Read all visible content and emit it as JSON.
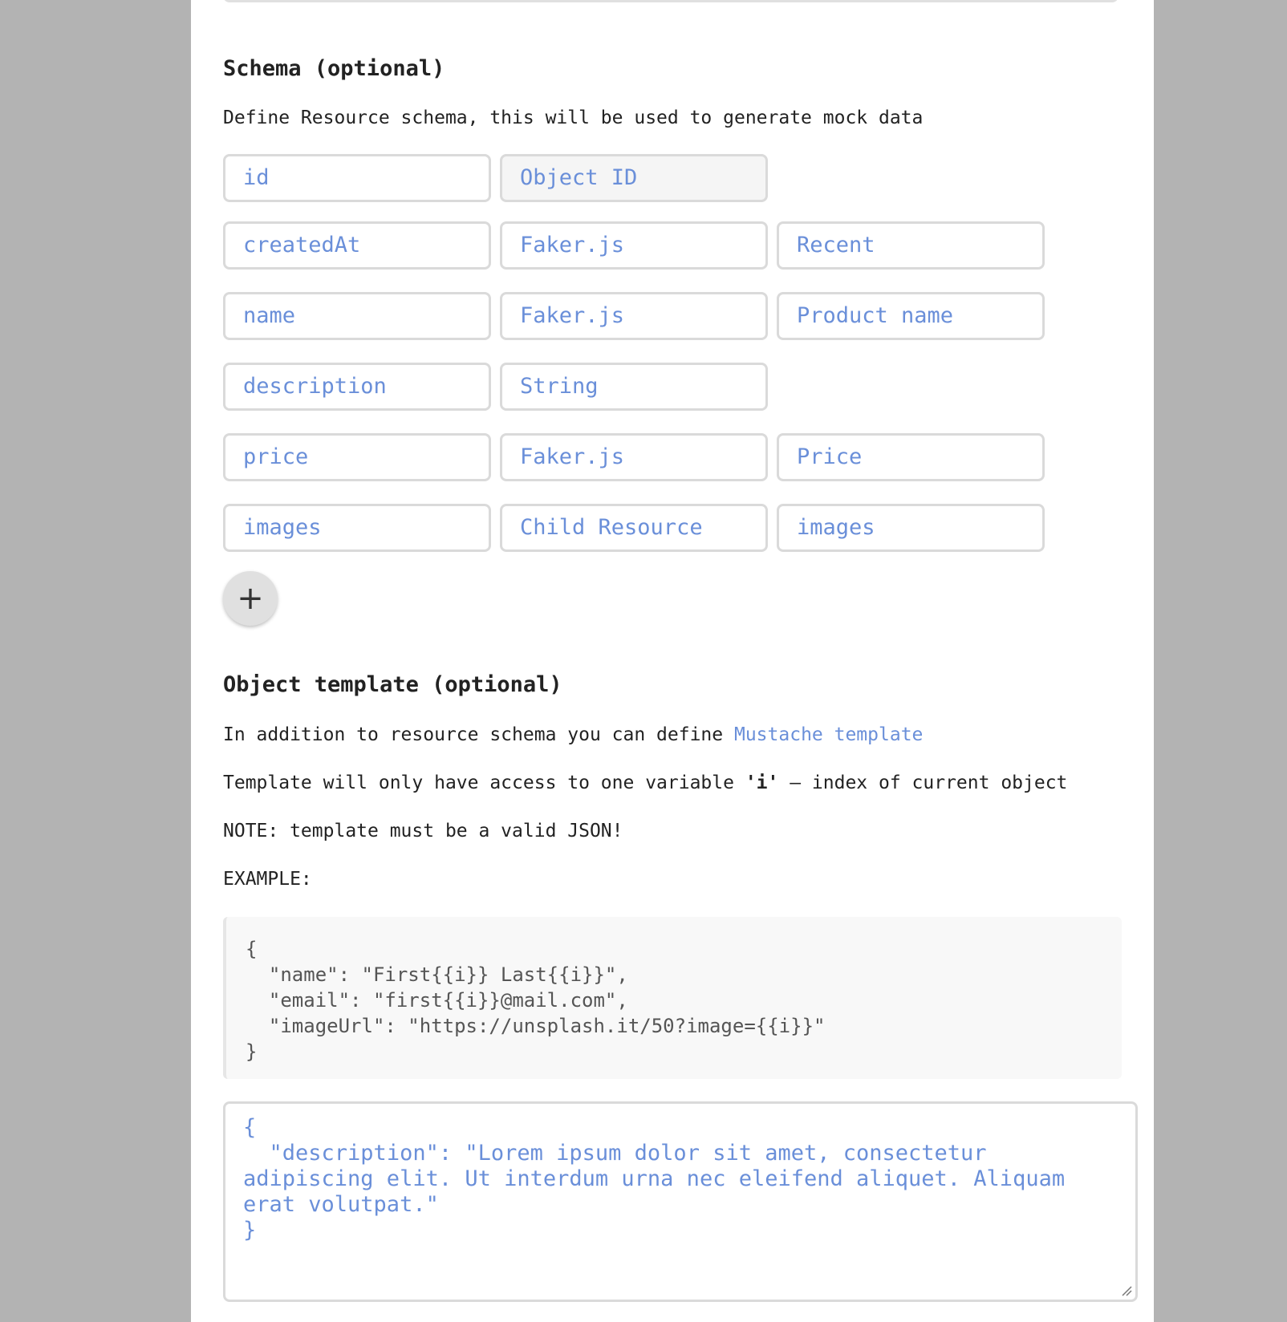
{
  "schema_section": {
    "title": "Schema (optional)",
    "description": "Define Resource schema, this will be used to generate mock data",
    "rows": [
      {
        "name": "id",
        "type": "Object ID",
        "option": null
      },
      {
        "name": "createdAt",
        "type": "Faker.js",
        "option": "Recent"
      },
      {
        "name": "name",
        "type": "Faker.js",
        "option": "Product name"
      },
      {
        "name": "description",
        "type": "String",
        "option": null
      },
      {
        "name": "price",
        "type": "Faker.js",
        "option": "Price"
      },
      {
        "name": "images",
        "type": "Child Resource",
        "option": "images"
      }
    ],
    "add_button": "+"
  },
  "template_section": {
    "title": "Object template (optional)",
    "line1_prefix": "In addition to resource schema you can define ",
    "line1_link": "Mustache template",
    "line2_prefix": "Template will only have access to one variable ",
    "line2_var": "'i'",
    "line2_suffix": " – index of current object",
    "note": "NOTE: template must be a valid JSON!",
    "example_label": "EXAMPLE:",
    "example_code": "{\n  \"name\": \"First{{i}} Last{{i}}\",\n  \"email\": \"first{{i}}@mail.com\",\n  \"imageUrl\": \"https://unsplash.it/50?image={{i}}\"\n}",
    "template_value": "{\n  \"description\": \"Lorem ipsum dolor sit amet, consectetur adipiscing elit. Ut interdum urna nec eleifend aliquet. Aliquam erat volutpat.\"\n}"
  },
  "colors": {
    "accent": "#6a8fd9",
    "background": "#b3b3b3",
    "panel": "#ffffff",
    "border": "#dadada"
  }
}
